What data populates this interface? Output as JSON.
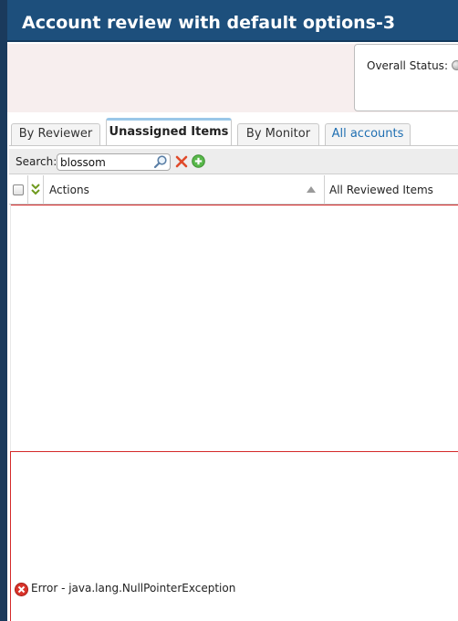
{
  "window": {
    "title": "Account review with default options-3"
  },
  "header": {
    "overall_status_label": "Overall Status:"
  },
  "tabs": [
    {
      "label": "By Reviewer",
      "active": false
    },
    {
      "label": "Unassigned Items",
      "active": true
    },
    {
      "label": "By Monitor",
      "active": false
    },
    {
      "label": "All accounts",
      "active": false,
      "link": true
    }
  ],
  "search": {
    "label": "Search:",
    "value": "blossom",
    "search_icon": "magnifier-icon",
    "clear_icon": "red-x-icon",
    "add_icon": "green-plus-icon"
  },
  "grid": {
    "columns": [
      "Actions",
      "All Reviewed Items"
    ],
    "sort_column": "Actions",
    "sort_direction": "ascending"
  },
  "error": {
    "message": "Error - java.lang.NullPointerException",
    "icon": "error-icon"
  },
  "colors": {
    "title_bar": "#1d4f7c",
    "header_bg": "#f7eeee",
    "link": "#1f6fb2",
    "error_border": "#d42a2a",
    "tab_active_accent": "#9ac7e8"
  }
}
